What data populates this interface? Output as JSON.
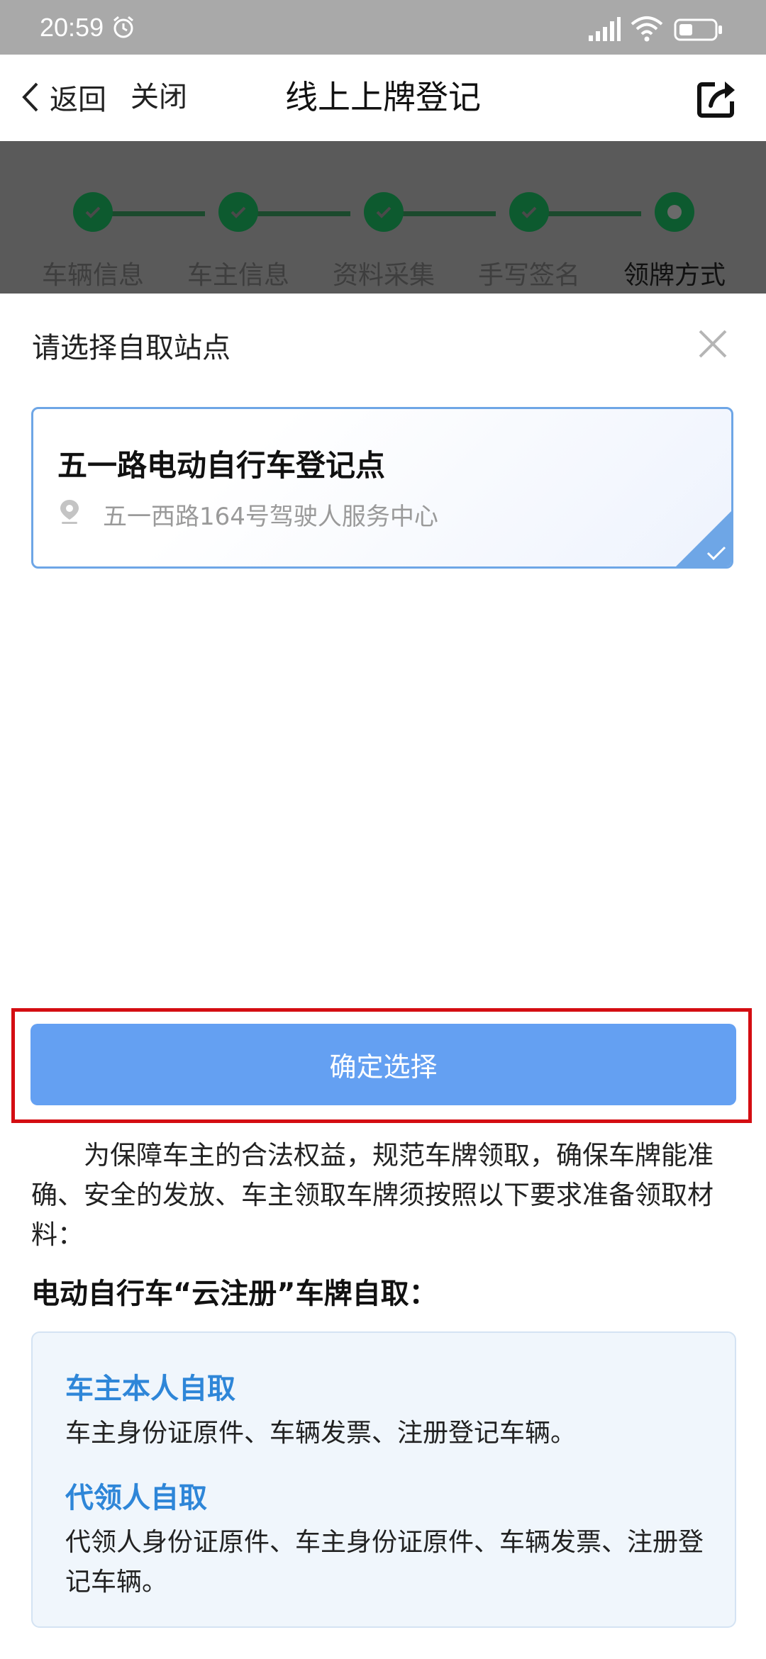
{
  "status_bar": {
    "time": "20:59"
  },
  "nav": {
    "back_label": "返回",
    "close_label": "关闭",
    "title": "线上上牌登记"
  },
  "steps": [
    {
      "label": "车辆信息",
      "state": "done"
    },
    {
      "label": "车主信息",
      "state": "done"
    },
    {
      "label": "资料采集",
      "state": "done"
    },
    {
      "label": "手写签名",
      "state": "done"
    },
    {
      "label": "领牌方式",
      "state": "current"
    }
  ],
  "sheet": {
    "title": "请选择自取站点",
    "station": {
      "name": "五一路电动自行车登记点",
      "address": "五一西路164号驾驶人服务中心",
      "selected": true
    },
    "confirm_label": "确定选择"
  },
  "notice": {
    "text": "为保障车主的合法权益，规范车牌领取，确保车牌能准确、安全的发放、车主领取车牌须按照以下要求准备领取材料：",
    "subheading": "电动自行车“云注册”车牌自取：",
    "options": [
      {
        "title": "车主本人自取",
        "text": "车主身份证原件、车辆发票、注册登记车辆。"
      },
      {
        "title": "代领人自取",
        "text": "代领人身份证原件、车主身份证原件、车辆发票、注册登记车辆。"
      }
    ]
  },
  "colors": {
    "accent_blue": "#64a0f2",
    "highlight_red": "#d40d12",
    "heading_blue": "#2e86d8",
    "step_green": "#0d5a2f"
  },
  "icons": [
    "alarm-icon",
    "signal-icon",
    "wifi-icon",
    "battery-icon",
    "back-chevron-icon",
    "share-icon",
    "check-icon",
    "close-icon",
    "location-pin-icon"
  ]
}
